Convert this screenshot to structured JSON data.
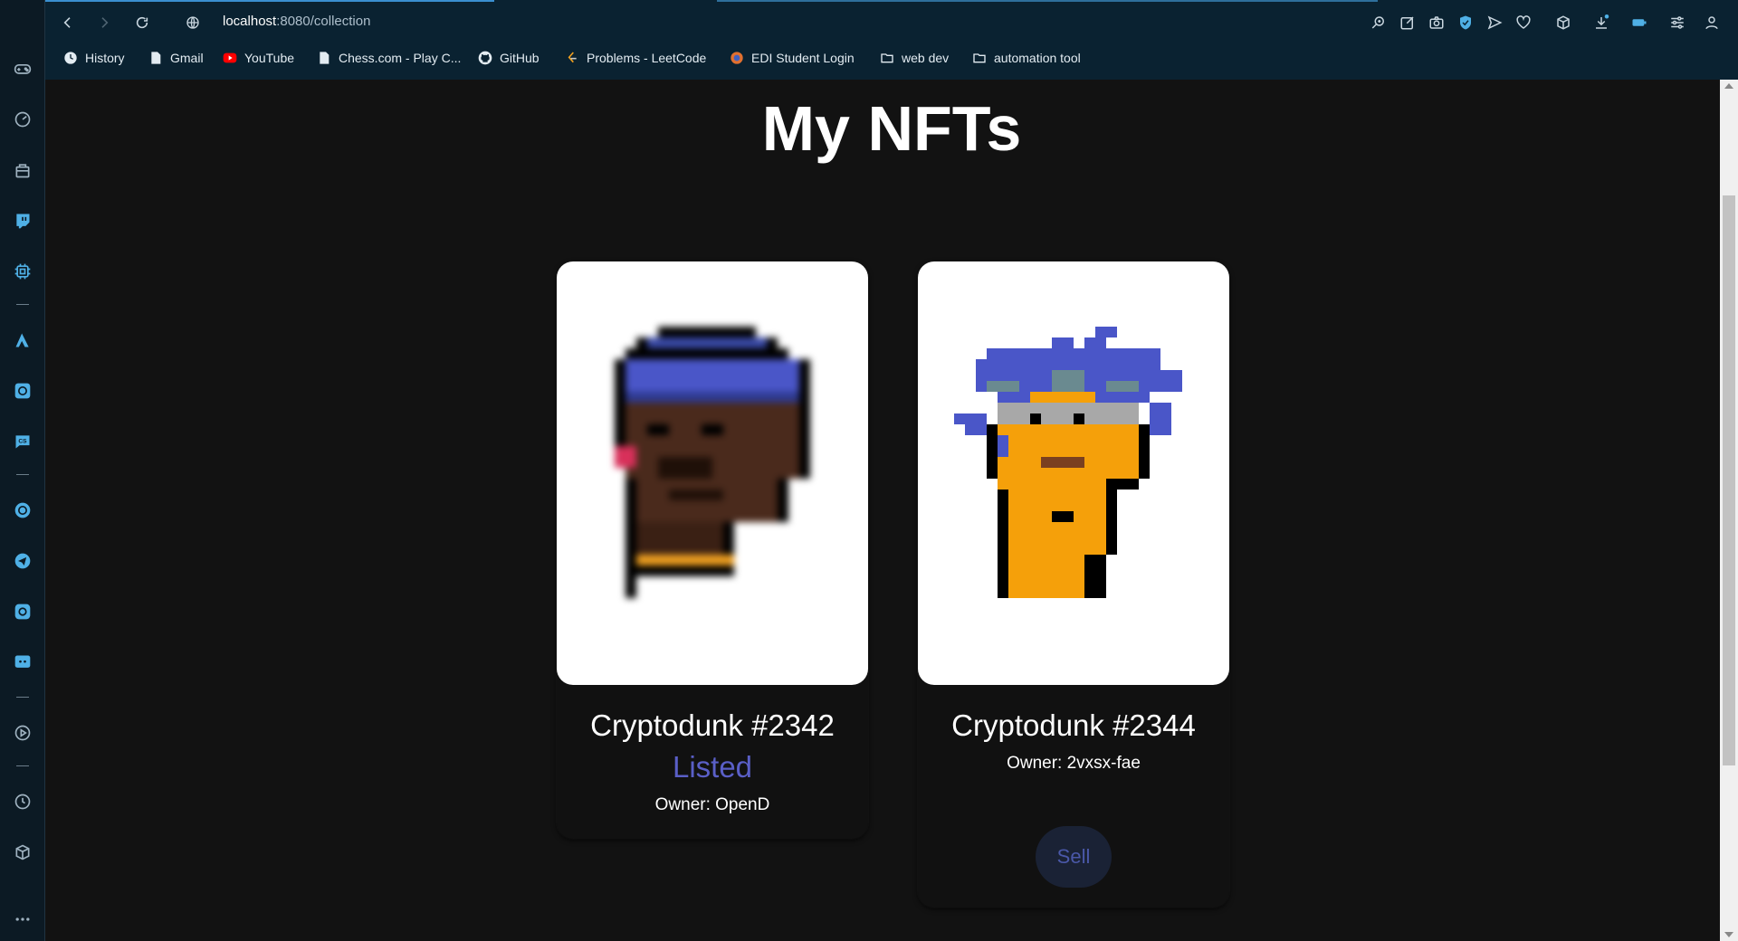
{
  "browser": {
    "url_host": "localhost",
    "url_port_path": ":8080/collection",
    "bookmarks": [
      {
        "label": "History",
        "icon": "history-icon"
      },
      {
        "label": "Gmail",
        "icon": "file-icon"
      },
      {
        "label": "YouTube",
        "icon": "youtube-icon"
      },
      {
        "label": "Chess.com - Play C...",
        "icon": "file-icon"
      },
      {
        "label": "GitHub",
        "icon": "github-icon"
      },
      {
        "label": "Problems - LeetCode",
        "icon": "leetcode-icon"
      },
      {
        "label": "EDI Student Login",
        "icon": "globe-icon"
      },
      {
        "label": "web dev",
        "icon": "folder-icon"
      },
      {
        "label": "automation tool",
        "icon": "folder-icon"
      }
    ]
  },
  "page": {
    "title": "My NFTs",
    "nfts": [
      {
        "name": "Cryptodunk #2342",
        "status": "Listed",
        "owner": "Owner: OpenD"
      },
      {
        "name": "Cryptodunk #2344",
        "owner": "Owner: 2vxsx-fae",
        "sell_label": "Sell"
      }
    ]
  },
  "colors": {
    "accent": "#5a5fc7",
    "browser_bar": "#0a2231",
    "page_bg": "#121212"
  }
}
